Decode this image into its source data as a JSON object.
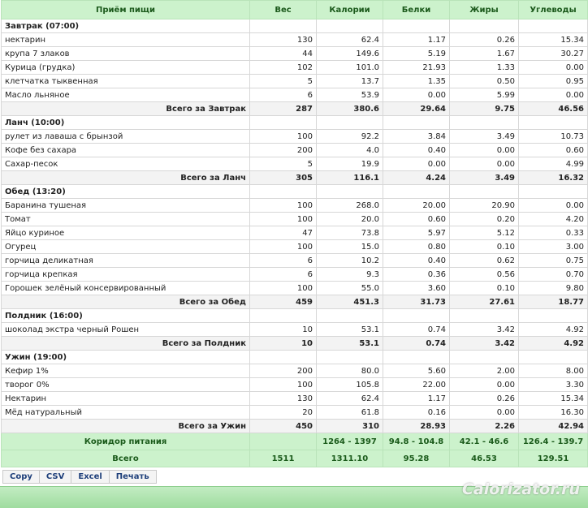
{
  "headers": [
    "Приём пищи",
    "Вес",
    "Калории",
    "Белки",
    "Жиры",
    "Углеводы"
  ],
  "meals": [
    {
      "title": "Завтрак (07:00)",
      "items": [
        [
          "нектарин",
          "130",
          "62.4",
          "1.17",
          "0.26",
          "15.34"
        ],
        [
          "крупа 7 злаков",
          "44",
          "149.6",
          "5.19",
          "1.67",
          "30.27"
        ],
        [
          "Курица (грудка)",
          "102",
          "101.0",
          "21.93",
          "1.33",
          "0.00"
        ],
        [
          "клетчатка тыквенная",
          "5",
          "13.7",
          "1.35",
          "0.50",
          "0.95"
        ],
        [
          "Масло льняное",
          "6",
          "53.9",
          "0.00",
          "5.99",
          "0.00"
        ]
      ],
      "total": [
        "Всего за Завтрак",
        "287",
        "380.6",
        "29.64",
        "9.75",
        "46.56"
      ]
    },
    {
      "title": "Ланч (10:00)",
      "items": [
        [
          "рулет из лаваша с брынзой",
          "100",
          "92.2",
          "3.84",
          "3.49",
          "10.73"
        ],
        [
          "Кофе без сахара",
          "200",
          "4.0",
          "0.40",
          "0.00",
          "0.60"
        ],
        [
          "Сахар-песок",
          "5",
          "19.9",
          "0.00",
          "0.00",
          "4.99"
        ]
      ],
      "total": [
        "Всего за Ланч",
        "305",
        "116.1",
        "4.24",
        "3.49",
        "16.32"
      ]
    },
    {
      "title": "Обед (13:20)",
      "items": [
        [
          "Баранина тушеная",
          "100",
          "268.0",
          "20.00",
          "20.90",
          "0.00"
        ],
        [
          "Томат",
          "100",
          "20.0",
          "0.60",
          "0.20",
          "4.20"
        ],
        [
          "Яйцо куриное",
          "47",
          "73.8",
          "5.97",
          "5.12",
          "0.33"
        ],
        [
          "Огурец",
          "100",
          "15.0",
          "0.80",
          "0.10",
          "3.00"
        ],
        [
          "горчица деликатная",
          "6",
          "10.2",
          "0.40",
          "0.62",
          "0.75"
        ],
        [
          "горчица крепкая",
          "6",
          "9.3",
          "0.36",
          "0.56",
          "0.70"
        ],
        [
          "Горошек зелёный консервированный",
          "100",
          "55.0",
          "3.60",
          "0.10",
          "9.80"
        ]
      ],
      "total": [
        "Всего за Обед",
        "459",
        "451.3",
        "31.73",
        "27.61",
        "18.77"
      ]
    },
    {
      "title": "Полдник (16:00)",
      "items": [
        [
          "шоколад экстра черный Рошен",
          "10",
          "53.1",
          "0.74",
          "3.42",
          "4.92"
        ]
      ],
      "total": [
        "Всего за Полдник",
        "10",
        "53.1",
        "0.74",
        "3.42",
        "4.92"
      ]
    },
    {
      "title": "Ужин (19:00)",
      "items": [
        [
          "Кефир 1%",
          "200",
          "80.0",
          "5.60",
          "2.00",
          "8.00"
        ],
        [
          "творог 0%",
          "100",
          "105.8",
          "22.00",
          "0.00",
          "3.30"
        ],
        [
          "Нектарин",
          "130",
          "62.4",
          "1.17",
          "0.26",
          "15.34"
        ],
        [
          "Мёд натуральный",
          "20",
          "61.8",
          "0.16",
          "0.00",
          "16.30"
        ]
      ],
      "total": [
        "Всего за Ужин",
        "450",
        "310",
        "28.93",
        "2.26",
        "42.94"
      ]
    }
  ],
  "corridor": [
    "Коридор питания",
    "",
    "1264 - 1397",
    "94.8 - 104.8",
    "42.1 - 46.6",
    "126.4 - 139.7"
  ],
  "grand_total": [
    "Всего",
    "1511",
    "1311.10",
    "95.28",
    "46.53",
    "129.51"
  ],
  "buttons": [
    "Copy",
    "CSV",
    "Excel",
    "Печать"
  ],
  "watermark": "Calorizator.ru"
}
